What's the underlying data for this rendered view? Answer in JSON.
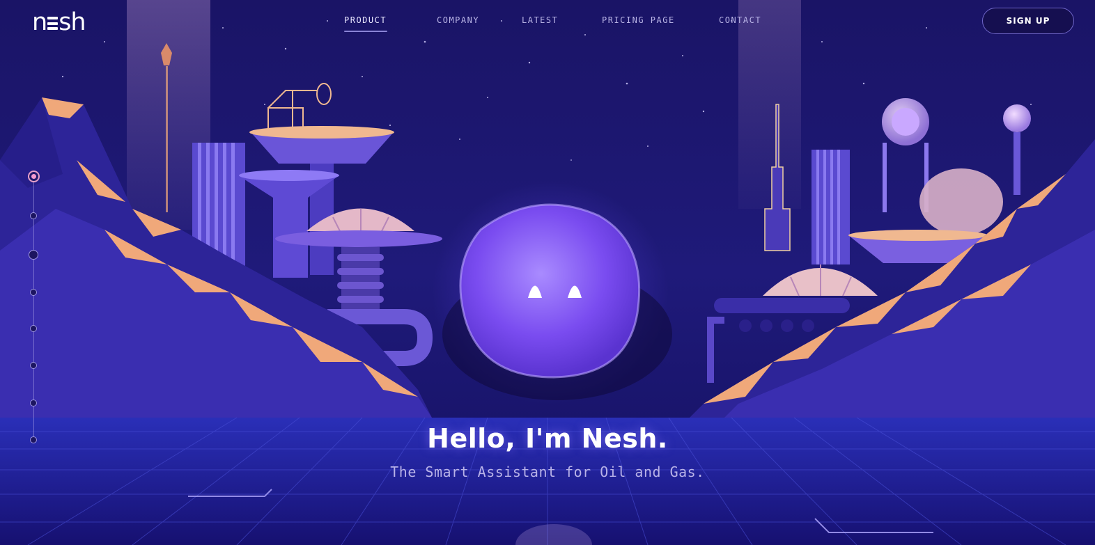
{
  "brand": {
    "logo_text": "nesh"
  },
  "nav": {
    "items": [
      {
        "label": "PRODUCT",
        "active": true
      },
      {
        "label": "COMPANY"
      },
      {
        "label": "LATEST"
      },
      {
        "label": "PRICING PAGE"
      },
      {
        "label": "CONTACT"
      }
    ]
  },
  "header": {
    "signup_label": "SIGN UP"
  },
  "hero": {
    "title": "Hello, I'm Nesh.",
    "subtitle": "The Smart Assistant for Oil and Gas."
  },
  "section_rail": {
    "active_index": 0,
    "count": 8
  },
  "colors": {
    "background": "#120e4a",
    "accent": "#8a5cff",
    "rock_highlight": "#f0a87a",
    "rail_active": "#f59ad0"
  }
}
